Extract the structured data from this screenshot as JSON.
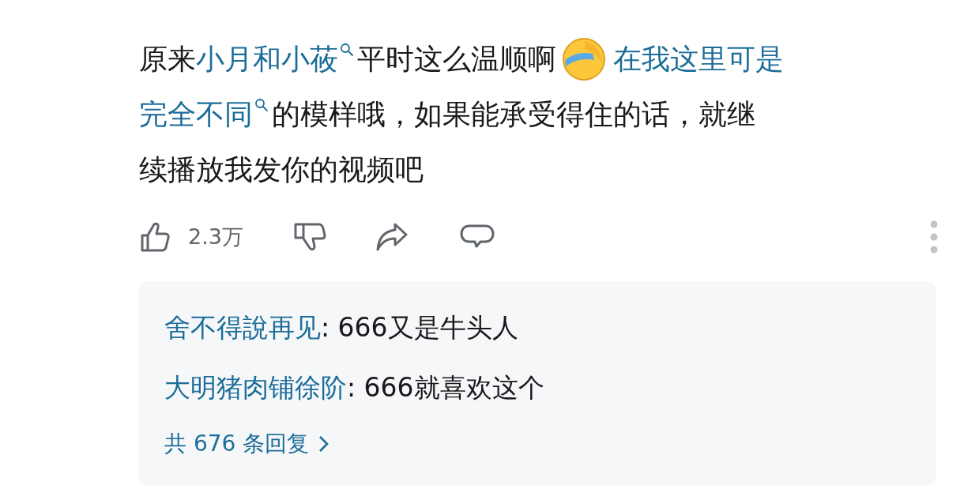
{
  "comment": {
    "lines": [
      [
        {
          "kind": "text",
          "text": "原来"
        },
        {
          "kind": "link",
          "text": "小月和小莜",
          "search": true
        },
        {
          "kind": "text",
          "text": "平时这么温顺啊"
        },
        {
          "kind": "emoji"
        },
        {
          "kind": "link",
          "text": "在我这里可是",
          "search": false
        }
      ],
      [
        {
          "kind": "link",
          "text": "完全不同",
          "search": true
        },
        {
          "kind": "text",
          "text": "的模样哦，如果能承受得住的话，就继"
        }
      ],
      [
        {
          "kind": "text",
          "text": "续播放我发你的视频吧"
        }
      ]
    ]
  },
  "actions": {
    "like_count": "2.3万",
    "liked": false,
    "disliked": false
  },
  "replies": {
    "items": [
      {
        "user": "舍不得說再见",
        "text": ": 666又是牛头人"
      },
      {
        "user": "大明猪肉铺徐阶",
        "text": ": 666就喜欢这个"
      }
    ],
    "more": "共 676 条回复"
  }
}
